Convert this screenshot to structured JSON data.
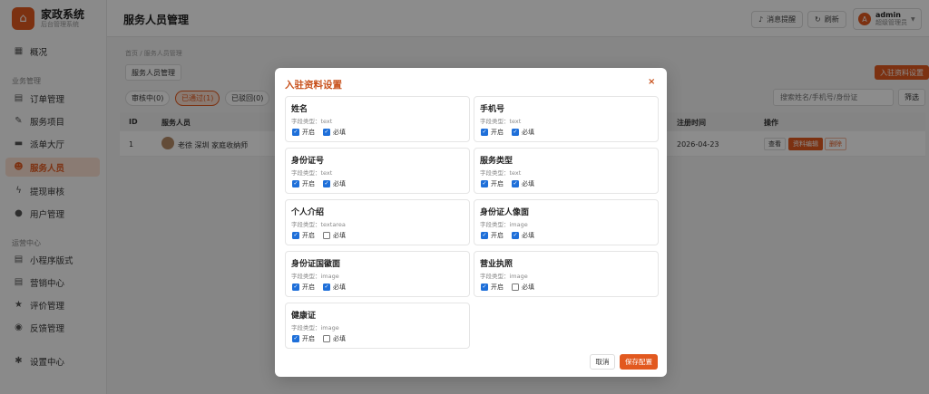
{
  "brand": {
    "title": "家政系统",
    "subtitle": "后台管理系统",
    "logo_icon": "home-icon"
  },
  "sidebar": {
    "items": [
      {
        "label": "概况",
        "icon": "grid-icon"
      },
      {
        "label": "订单管理",
        "icon": "document-icon"
      },
      {
        "label": "服务项目",
        "icon": "wrench-icon"
      },
      {
        "label": "派单大厅",
        "icon": "monitor-icon"
      },
      {
        "label": "服务人员",
        "icon": "users-icon",
        "active": true
      },
      {
        "label": "提现审核",
        "icon": "bolt-icon"
      },
      {
        "label": "用户管理",
        "icon": "user-icon"
      },
      {
        "label": "小程序版式",
        "icon": "document-icon"
      },
      {
        "label": "营销中心",
        "icon": "document-icon"
      },
      {
        "label": "评价管理",
        "icon": "star-icon"
      },
      {
        "label": "反馈管理",
        "icon": "chat-icon"
      },
      {
        "label": "设置中心",
        "icon": "gear-icon"
      }
    ],
    "sections": {
      "business": "业务管理",
      "operations": "运营中心"
    }
  },
  "header": {
    "title": "服务人员管理",
    "notify_label": "消息提醒",
    "refresh_label": "刷新",
    "user": {
      "name": "admin",
      "role": "超级管理员",
      "avatar_letter": "A"
    }
  },
  "main": {
    "breadcrumb": "首页 / 服务人员管理",
    "subtitle_tab": "服务人员管理",
    "config_button": "入驻资料设置",
    "filter_tabs": [
      "审核中(0)",
      "已通过(1)",
      "已驳回(0)"
    ],
    "search_placeholder": "搜索姓名/手机号/身份证",
    "filter_button": "筛选",
    "table": {
      "headers": {
        "id": "ID",
        "staff": "服务人员",
        "registered": "注册时间",
        "actions": "操作"
      },
      "rows": [
        {
          "id": "1",
          "name": "老徐 深圳 家庭收纳师",
          "registered": "2026-04-23",
          "actions": [
            "查看",
            "资料编辑",
            "删除"
          ]
        }
      ]
    }
  },
  "modal": {
    "title": "入驻资料设置",
    "close": "×",
    "type_prefix": "字段类型：",
    "enable_label": "开启",
    "required_label": "必填",
    "fields": [
      {
        "name": "姓名",
        "type": "text",
        "enabled": true,
        "required": true
      },
      {
        "name": "手机号",
        "type": "text",
        "enabled": true,
        "required": true
      },
      {
        "name": "身份证号",
        "type": "text",
        "enabled": true,
        "required": true
      },
      {
        "name": "服务类型",
        "type": "text",
        "enabled": true,
        "required": true
      },
      {
        "name": "个人介绍",
        "type": "textarea",
        "enabled": true,
        "required": false
      },
      {
        "name": "身份证人像面",
        "type": "image",
        "enabled": true,
        "required": true
      },
      {
        "name": "身份证国徽面",
        "type": "image",
        "enabled": true,
        "required": true
      },
      {
        "name": "营业执照",
        "type": "image",
        "enabled": true,
        "required": false
      },
      {
        "name": "健康证",
        "type": "image",
        "enabled": true,
        "required": false
      }
    ],
    "cancel_label": "取消",
    "save_label": "保存配置"
  },
  "colors": {
    "accent": "#e2591f",
    "checkbox": "#1e6fd9",
    "overlay": "rgba(0,0,0,0.45)"
  }
}
